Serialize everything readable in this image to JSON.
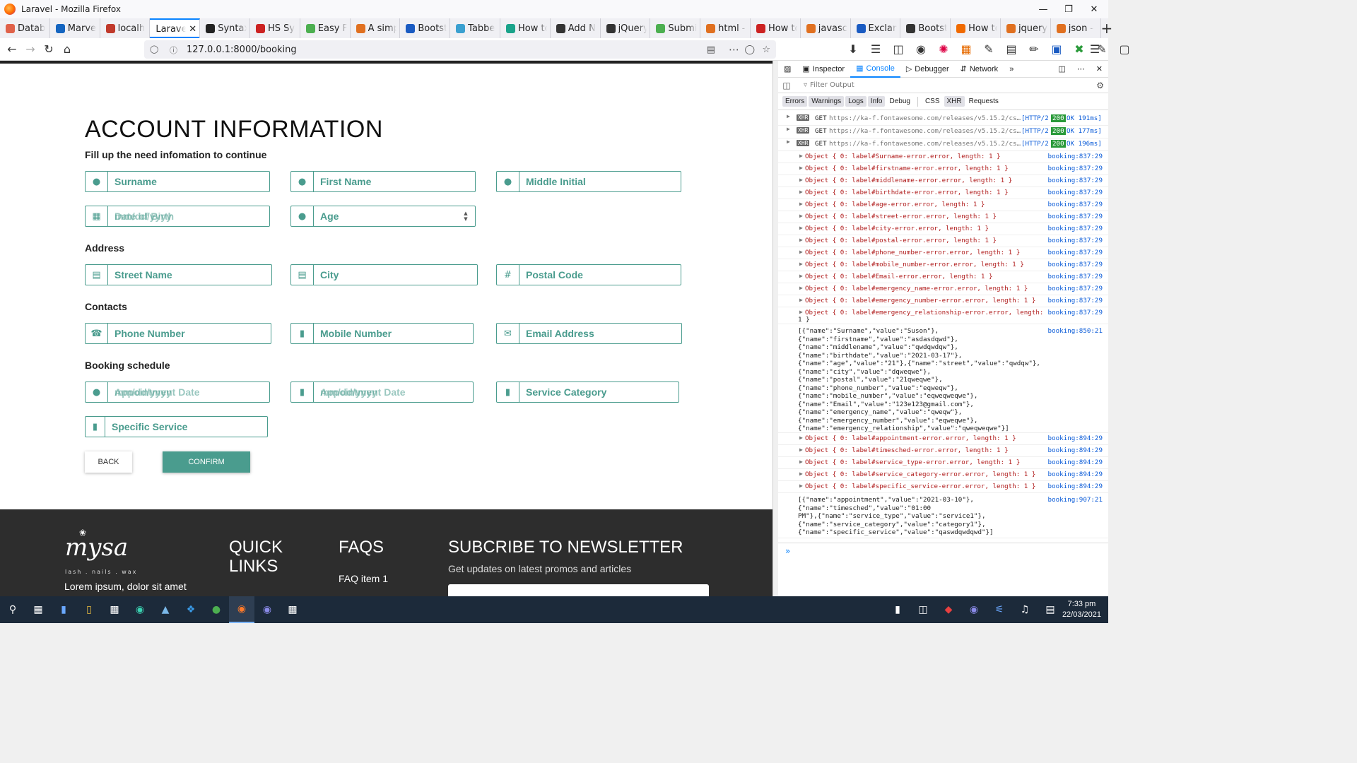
{
  "window": {
    "title": "Laravel - Mozilla Firefox"
  },
  "tabs": [
    {
      "label": "Datab",
      "color": "#e0624a",
      "icon": "laravel-icon"
    },
    {
      "label": "Marve",
      "color": "#1565c0",
      "icon": "marvel-icon"
    },
    {
      "label": "localh",
      "color": "#c0392b",
      "icon": "localhost-icon"
    },
    {
      "label": "Laravel",
      "color": "#fff",
      "icon": "none",
      "active": true
    },
    {
      "label": "Syntax",
      "color": "#222",
      "icon": "github-icon"
    },
    {
      "label": "HS Sy",
      "color": "#c22",
      "icon": "hs-icon"
    },
    {
      "label": "Easy F",
      "color": "#4caf50",
      "icon": "leaf-icon"
    },
    {
      "label": "A simp",
      "color": "#e07020",
      "icon": "page-icon"
    },
    {
      "label": "Bootst",
      "color": "#1a5bc2",
      "icon": "bootstrap-icon"
    },
    {
      "label": "Tabbe",
      "color": "#3aa0d0",
      "icon": "cloud-icon"
    },
    {
      "label": "How tc",
      "color": "#1aa38a",
      "icon": "w3-icon"
    },
    {
      "label": "Add N",
      "color": "#333",
      "icon": "jquery-icon"
    },
    {
      "label": "jQuery",
      "color": "#333",
      "icon": "jquery-icon"
    },
    {
      "label": "Submi",
      "color": "#4caf50",
      "icon": "leaf-icon"
    },
    {
      "label": "html -",
      "color": "#e07020",
      "icon": "page-icon"
    },
    {
      "label": "How tc",
      "color": "#c22",
      "icon": "quora-icon"
    },
    {
      "label": "javasc",
      "color": "#e07020",
      "icon": "page-icon"
    },
    {
      "label": "Exclan",
      "color": "#1a5bc2",
      "icon": "bootstrap-icon"
    },
    {
      "label": "Bootst",
      "color": "#333",
      "icon": "github-icon"
    },
    {
      "label": "How tc",
      "color": "#f06a00",
      "icon": "so-icon"
    },
    {
      "label": "jquery",
      "color": "#e07020",
      "icon": "page-icon"
    },
    {
      "label": "json -",
      "color": "#e07020",
      "icon": "page-icon"
    }
  ],
  "nav": {
    "url": "127.0.0.1:8000/booking"
  },
  "form": {
    "title": "ACCOUNT INFORMATION",
    "subtitle": "Fill up the need infomation to continue",
    "sections": {
      "address": "Address",
      "contacts": "Contacts",
      "booking": "Booking schedule"
    },
    "fields": {
      "surname": "Surname",
      "first_name": "First Name",
      "middle_initial": "Middle Initial",
      "birthdate": "Date of Birth",
      "birthdate_overlay": "mm/dd/yyyy",
      "age": "Age",
      "street": "Street Name",
      "city": "City",
      "postal": "Postal Code",
      "phone": "Phone Number",
      "mobile": "Mobile Number",
      "email": "Email Address",
      "appointment": "Appointment Date",
      "appointment_overlay": "mm/dd/yyyy",
      "timesched": "Appointment Date",
      "timesched_overlay": "mm/dd/yyyy",
      "service_category": "Service Category",
      "specific_service": "Specific Service"
    },
    "buttons": {
      "back": "BACK",
      "confirm": "CONFIRM"
    },
    "accent": "#4a9c8e"
  },
  "footer": {
    "logo": "mysa",
    "logo_sub": "lash . nails . wax",
    "tagline": "Lorem ipsum, dolor sit amet",
    "quick_links": "QUICK LINKS",
    "faqs": "FAQS",
    "faq_item": "FAQ item 1",
    "newsletter": "SUBCRIBE TO NEWSLETTER",
    "newsletter_sub": "Get updates on latest promos and articles"
  },
  "devtools": {
    "tabs": [
      "Inspector",
      "Console",
      "Debugger",
      "Network"
    ],
    "filter_placeholder": "Filter Output",
    "levels": [
      "Errors",
      "Warnings",
      "Logs",
      "Info",
      "Debug",
      "CSS",
      "XHR",
      "Requests"
    ],
    "xhr": [
      {
        "method": "GET",
        "url": "https://ka-f.fontawesome.com/releases/v5.15.2/cs…",
        "proto": "[HTTP/2",
        "status": "200",
        "ok": "OK 191ms]"
      },
      {
        "method": "GET",
        "url": "https://ka-f.fontawesome.com/releases/v5.15.2/cs…",
        "proto": "[HTTP/2",
        "status": "200",
        "ok": "OK 177ms]"
      },
      {
        "method": "GET",
        "url": "https://ka-f.fontawesome.com/releases/v5.15.2/cs…",
        "proto": "[HTTP/2",
        "status": "200",
        "ok": "OK 196ms]"
      }
    ],
    "objects1": [
      "Object { 0: label#Surname-error.error, length: 1 }",
      "Object { 0: label#firstname-error.error, length: 1 }",
      "Object { 0: label#middlename-error.error, length: 1 }",
      "Object { 0: label#birthdate-error.error, length: 1 }",
      "Object { 0: label#age-error.error, length: 1 }",
      "Object { 0: label#street-error.error, length: 1 }",
      "Object { 0: label#city-error.error, length: 1 }",
      "Object { 0: label#postal-error.error, length: 1 }",
      "Object { 0: label#phone_number-error.error, length: 1 }",
      "Object { 0: label#mobile_number-error.error, length: 1 }",
      "Object { 0: label#Email-error.error, length: 1 }",
      "Object { 0: label#emergency_name-error.error, length: 1 }",
      "Object { 0: label#emergency_number-error.error, length: 1 }",
      "Object { 0: label#emergency_relationship-error.error, length:"
    ],
    "objects1_loc": "booking:837:29",
    "objects1_tail": "1 }",
    "json1": [
      "[{\"name\":\"Surname\",\"value\":\"Suson\"},",
      "{\"name\":\"firstname\",\"value\":\"asdasdqwd\"},",
      "{\"name\":\"middlename\",\"value\":\"qwdqwdqw\"},",
      "{\"name\":\"birthdate\",\"value\":\"2021-03-17\"},",
      "{\"name\":\"age\",\"value\":\"21\"},{\"name\":\"street\",\"value\":\"qwdqw\"},",
      "{\"name\":\"city\",\"value\":\"dqweqwe\"},",
      "{\"name\":\"postal\",\"value\":\"21qweqwe\"},",
      "{\"name\":\"phone_number\",\"value\":\"eqweqw\"},",
      "{\"name\":\"mobile_number\",\"value\":\"eqweqweqwe\"},",
      "{\"name\":\"Email\",\"value\":\"123e123@gmail.com\"},",
      "{\"name\":\"emergency_name\",\"value\":\"qweqw\"},",
      "{\"name\":\"emergency_number\",\"value\":\"eqweqwe\"},",
      "{\"name\":\"emergency_relationship\",\"value\":\"qweqweqwe\"}]"
    ],
    "json1_loc": "booking:850:21",
    "objects2": [
      "Object { 0: label#appointment-error.error, length: 1 }",
      "Object { 0: label#timesched-error.error, length: 1 }",
      "Object { 0: label#service_type-error.error, length: 1 }",
      "Object { 0: label#service_category-error.error, length: 1 }",
      "Object { 0: label#specific_service-error.error, length: 1 }"
    ],
    "objects2_loc": "booking:894:29",
    "json2": [
      "[{\"name\":\"appointment\",\"value\":\"2021-03-10\"},",
      "{\"name\":\"timesched\",\"value\":\"01:00",
      "PM\"},{\"name\":\"service_type\",\"value\":\"service1\"},",
      "{\"name\":\"service_category\",\"value\":\"category1\"},",
      "{\"name\":\"specific_service\",\"value\":\"qaswdqwdqwd\"}]"
    ],
    "json2_loc": "booking:907:21"
  },
  "taskbar": {
    "time": "7:33 pm",
    "date": "22/03/2021"
  }
}
